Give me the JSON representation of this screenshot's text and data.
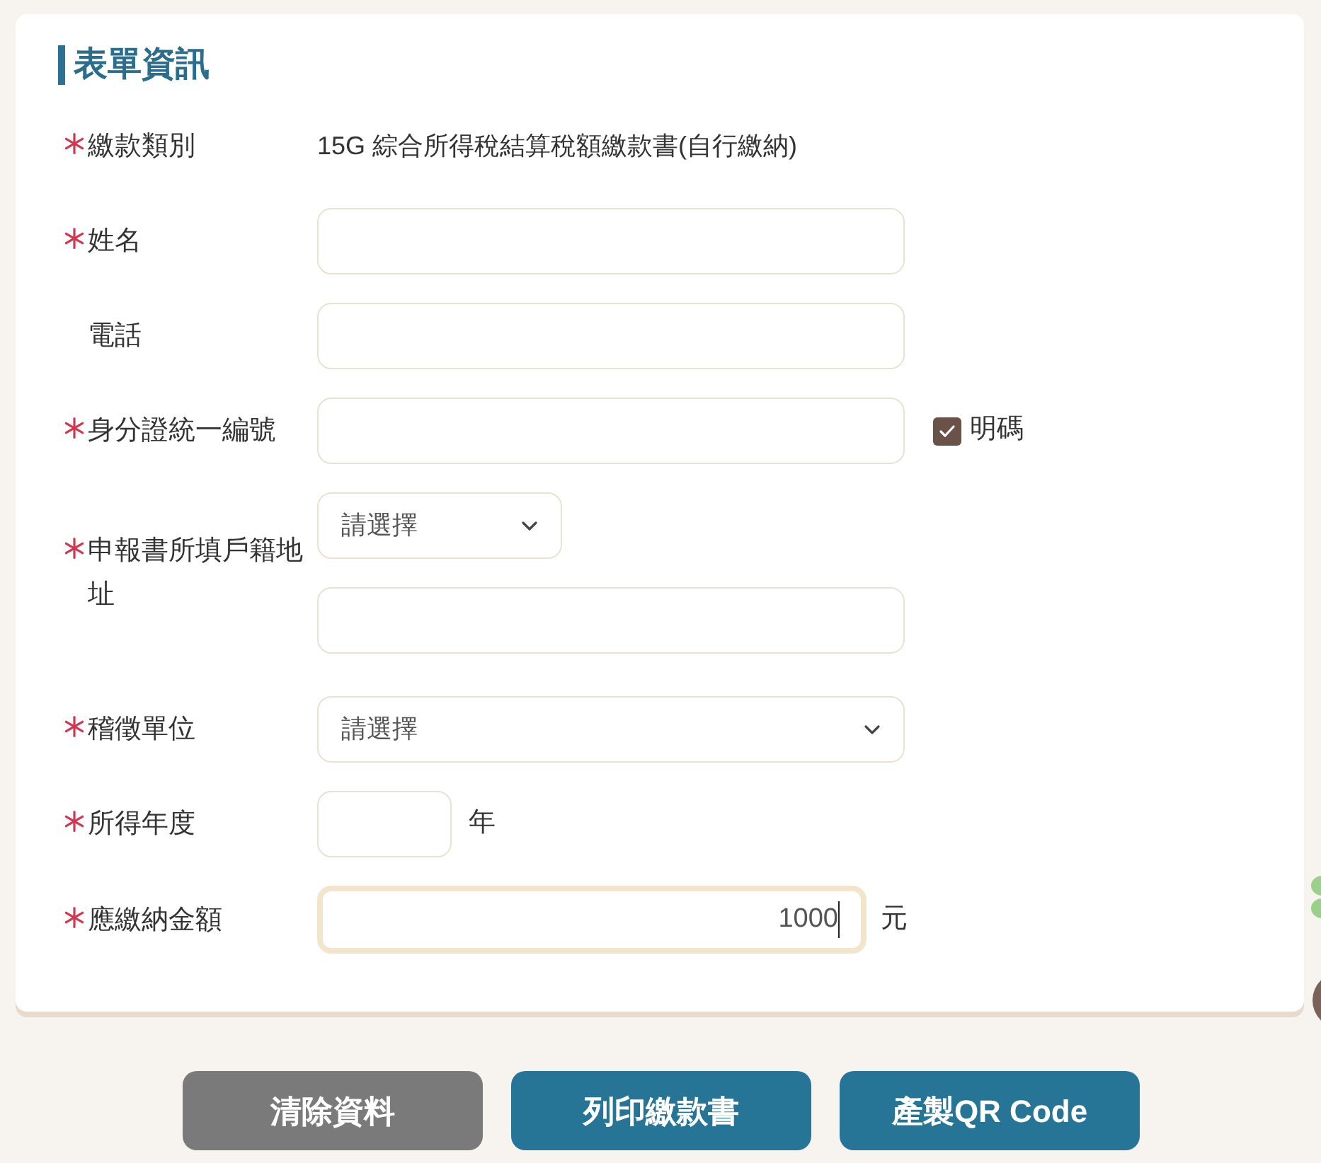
{
  "form": {
    "title": "表單資訊",
    "fields": [
      {
        "kind": "text",
        "label": "繳款類別",
        "required": true,
        "value": "15G 綜合所得稅結算稅額繳款書(自行繳納)"
      },
      {
        "kind": "input",
        "label": "姓名",
        "required": true
      },
      {
        "kind": "input",
        "label": "電話",
        "required": false
      },
      {
        "kind": "input",
        "label": "身分證統一編號",
        "required": true,
        "toggle": {
          "label": "明碼",
          "checked": true
        }
      },
      {
        "kind": "address",
        "label": "申報書所填戶籍地址",
        "required": true,
        "placeholder": "請選擇"
      },
      {
        "kind": "select",
        "label": "稽徵單位",
        "required": true,
        "placeholder": "請選擇"
      },
      {
        "kind": "short_input",
        "label": "所得年度",
        "required": true,
        "unit": "年"
      },
      {
        "kind": "amount",
        "label": "應繳納金額",
        "required": true,
        "value": "1000",
        "unit": "元",
        "focused": true
      }
    ]
  },
  "buttons": [
    {
      "label": "清除資料",
      "kind": "secondary"
    },
    {
      "label": "列印繳款書",
      "kind": "primary"
    },
    {
      "label": "產製QR Code",
      "kind": "primary"
    }
  ]
}
